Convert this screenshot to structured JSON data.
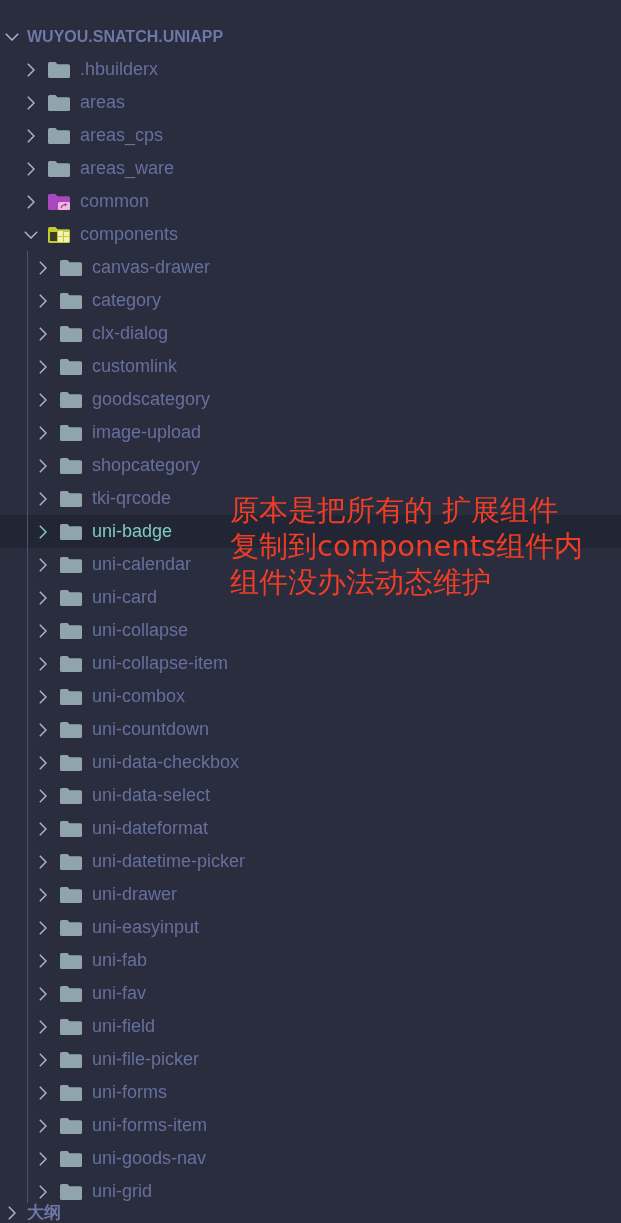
{
  "explorer": {
    "title": "WUYOU.SNATCH.UNIAPP",
    "expanded": true,
    "items": [
      {
        "name": ".hbuilderx",
        "kind": "folder",
        "expanded": false,
        "selected": false
      },
      {
        "name": "areas",
        "kind": "folder",
        "expanded": false,
        "selected": false
      },
      {
        "name": "areas_cps",
        "kind": "folder",
        "expanded": false,
        "selected": false
      },
      {
        "name": "areas_ware",
        "kind": "folder",
        "expanded": false,
        "selected": false
      },
      {
        "name": "common",
        "kind": "shared",
        "expanded": false,
        "selected": false
      },
      {
        "name": "components",
        "kind": "modules",
        "expanded": true,
        "selected": false,
        "children": [
          {
            "name": "canvas-drawer",
            "kind": "folder",
            "expanded": false,
            "selected": false
          },
          {
            "name": "category",
            "kind": "folder",
            "expanded": false,
            "selected": false
          },
          {
            "name": "clx-dialog",
            "kind": "folder",
            "expanded": false,
            "selected": false
          },
          {
            "name": "customlink",
            "kind": "folder",
            "expanded": false,
            "selected": false
          },
          {
            "name": "goodscategory",
            "kind": "folder",
            "expanded": false,
            "selected": false
          },
          {
            "name": "image-upload",
            "kind": "folder",
            "expanded": false,
            "selected": false
          },
          {
            "name": "shopcategory",
            "kind": "folder",
            "expanded": false,
            "selected": false
          },
          {
            "name": "tki-qrcode",
            "kind": "folder",
            "expanded": false,
            "selected": false
          },
          {
            "name": "uni-badge",
            "kind": "folder",
            "expanded": false,
            "selected": true
          },
          {
            "name": "uni-calendar",
            "kind": "folder",
            "expanded": false,
            "selected": false
          },
          {
            "name": "uni-card",
            "kind": "folder",
            "expanded": false,
            "selected": false
          },
          {
            "name": "uni-collapse",
            "kind": "folder",
            "expanded": false,
            "selected": false
          },
          {
            "name": "uni-collapse-item",
            "kind": "folder",
            "expanded": false,
            "selected": false
          },
          {
            "name": "uni-combox",
            "kind": "folder",
            "expanded": false,
            "selected": false
          },
          {
            "name": "uni-countdown",
            "kind": "folder",
            "expanded": false,
            "selected": false
          },
          {
            "name": "uni-data-checkbox",
            "kind": "folder",
            "expanded": false,
            "selected": false
          },
          {
            "name": "uni-data-select",
            "kind": "folder",
            "expanded": false,
            "selected": false
          },
          {
            "name": "uni-dateformat",
            "kind": "folder",
            "expanded": false,
            "selected": false
          },
          {
            "name": "uni-datetime-picker",
            "kind": "folder",
            "expanded": false,
            "selected": false
          },
          {
            "name": "uni-drawer",
            "kind": "folder",
            "expanded": false,
            "selected": false
          },
          {
            "name": "uni-easyinput",
            "kind": "folder",
            "expanded": false,
            "selected": false
          },
          {
            "name": "uni-fab",
            "kind": "folder",
            "expanded": false,
            "selected": false
          },
          {
            "name": "uni-fav",
            "kind": "folder",
            "expanded": false,
            "selected": false
          },
          {
            "name": "uni-field",
            "kind": "folder",
            "expanded": false,
            "selected": false
          },
          {
            "name": "uni-file-picker",
            "kind": "folder",
            "expanded": false,
            "selected": false
          },
          {
            "name": "uni-forms",
            "kind": "folder",
            "expanded": false,
            "selected": false
          },
          {
            "name": "uni-forms-item",
            "kind": "folder",
            "expanded": false,
            "selected": false
          },
          {
            "name": "uni-goods-nav",
            "kind": "folder",
            "expanded": false,
            "selected": false
          },
          {
            "name": "uni-grid",
            "kind": "folder",
            "expanded": false,
            "selected": false
          }
        ]
      }
    ]
  },
  "outline": {
    "title": "大纲",
    "expanded": false
  },
  "annotation": {
    "lines": [
      "原本是把所有的 扩展组件",
      "复制到components组件内",
      "组件没办法动态维护"
    ]
  }
}
